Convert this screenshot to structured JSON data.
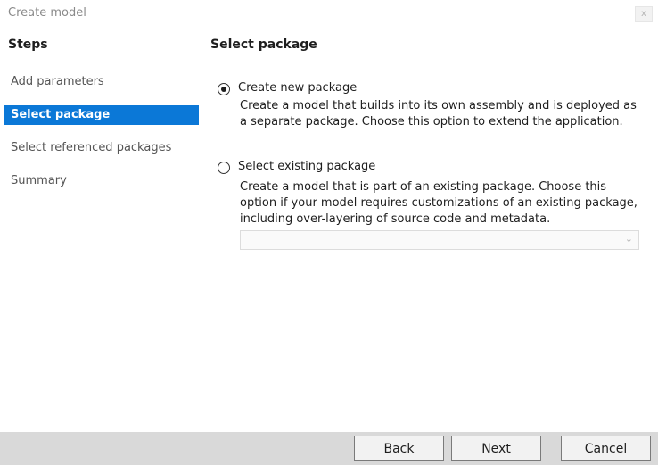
{
  "window": {
    "title": "Create model",
    "close_label": "x"
  },
  "steps": {
    "heading": "Steps",
    "items": [
      {
        "label": "Add parameters",
        "selected": false
      },
      {
        "label": "Select package",
        "selected": true
      },
      {
        "label": "Select referenced packages",
        "selected": false
      },
      {
        "label": "Summary",
        "selected": false
      }
    ]
  },
  "main": {
    "heading": "Select package",
    "options": [
      {
        "label": "Create new package",
        "checked": true,
        "description": "Create a model that builds into its own assembly and is deployed as a separate package. Choose this option to extend the application."
      },
      {
        "label": "Select existing package",
        "checked": false,
        "description": "Create a model that is part of an existing package. Choose this option if your model requires customizations of an existing package, including over-layering of source code and metadata."
      }
    ],
    "existing_package_dropdown": {
      "value": "",
      "chevron_icon": "chevron-down-icon",
      "enabled": false
    }
  },
  "footer": {
    "back_label": "Back",
    "next_label": "Next",
    "cancel_label": "Cancel"
  },
  "colors": {
    "accent": "#0b78d7",
    "footer_bg": "#d9d9d9"
  }
}
